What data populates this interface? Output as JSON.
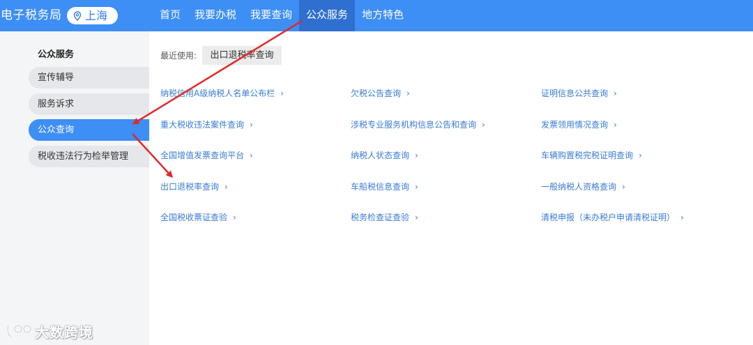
{
  "header": {
    "brand": "电子税务局",
    "city": "上海",
    "nav": [
      "首页",
      "我要办税",
      "我要查询",
      "公众服务",
      "地方特色"
    ],
    "active_nav": "公众服务"
  },
  "sidebar": {
    "title": "公众服务",
    "items": [
      "宣传辅导",
      "服务诉求",
      "公众查询",
      "税收违法行为检举管理"
    ],
    "active_item": "公众查询"
  },
  "recent": {
    "label": "最近使用:",
    "item": "出口退税率查询"
  },
  "links": [
    [
      "纳税信用A级纳税人名单公布栏",
      "欠税公告查询",
      "证明信息公共查询"
    ],
    [
      "重大税收违法案件查询",
      "涉税专业服务机构信息公告和查询",
      "发票领用情况查询"
    ],
    [
      "全国增值发票查询平台",
      "纳税人状态查询",
      "车辆购置税完税证明查询"
    ],
    [
      "出口退税率查询",
      "车船税信息查询",
      "一般纳税人资格查询"
    ],
    [
      "全国税收票证查验",
      "税务检查证查验",
      "清税申报（未办税户申请清税证明）"
    ]
  ],
  "chevron": "›",
  "watermark": "大数跨境",
  "colors": {
    "primary": "#3d8ef5",
    "nav_active": "#2e6fd0",
    "link": "#3a7bd5",
    "annotation_arrow": "#e02a2a"
  }
}
